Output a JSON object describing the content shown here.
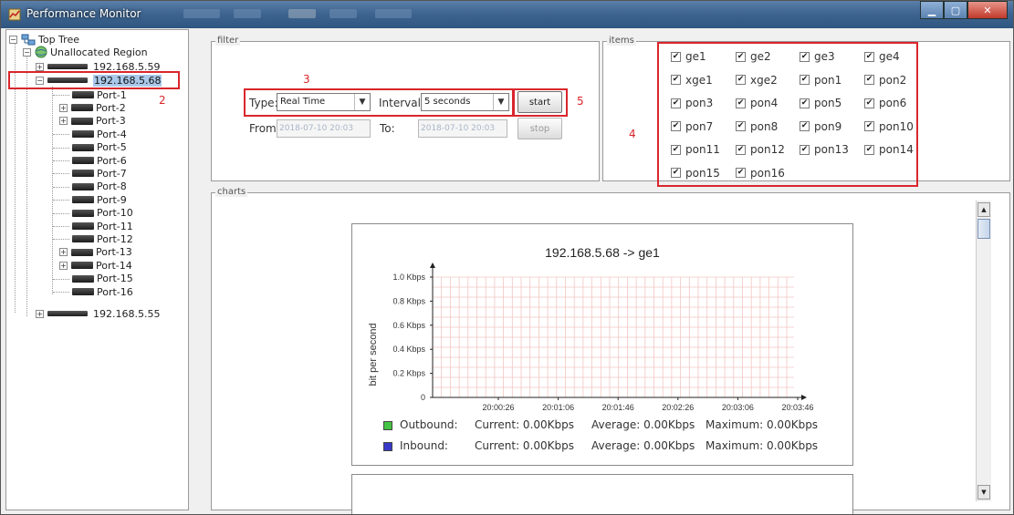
{
  "window": {
    "title": "Performance Monitor"
  },
  "tree": {
    "root": "Top Tree",
    "region": "Unallocated Region",
    "devices": [
      "192.168.5.59",
      "192.168.5.68",
      "192.168.5.55"
    ],
    "ports": [
      "Port-1",
      "Port-2",
      "Port-3",
      "Port-4",
      "Port-5",
      "Port-6",
      "Port-7",
      "Port-8",
      "Port-9",
      "Port-10",
      "Port-11",
      "Port-12",
      "Port-13",
      "Port-14",
      "Port-15",
      "Port-16"
    ]
  },
  "annotations": {
    "n2": "2",
    "n3": "3",
    "n4": "4",
    "n5": "5"
  },
  "filter": {
    "title": "filter",
    "type_label": "Type:",
    "type_value": "Real Time",
    "interval_label": "Interval:",
    "interval_value": "5 seconds",
    "from_label": "From:",
    "from_value": "2018-07-10 20:03",
    "to_label": "To:",
    "to_value": "2018-07-10 20:03",
    "start_label": "start",
    "stop_label": "stop"
  },
  "items": {
    "title": "items",
    "list": [
      "ge1",
      "ge2",
      "ge3",
      "ge4",
      "xge1",
      "xge2",
      "pon1",
      "pon2",
      "pon3",
      "pon4",
      "pon5",
      "pon6",
      "pon7",
      "pon8",
      "pon9",
      "pon10",
      "pon11",
      "pon12",
      "pon13",
      "pon14",
      "pon15",
      "pon16"
    ]
  },
  "charts": {
    "title": "charts",
    "legend": {
      "outbound": {
        "label": "Outbound:",
        "current": "Current: 0.00Kbps",
        "average": "Average: 0.00Kbps",
        "maximum": "Maximum: 0.00Kbps",
        "color": "#44c444"
      },
      "inbound": {
        "label": "Inbound:",
        "current": "Current: 0.00Kbps",
        "average": "Average: 0.00Kbps",
        "maximum": "Maximum: 0.00Kbps",
        "color": "#3a3ac8"
      }
    }
  },
  "chart_data": {
    "type": "line",
    "title": "192.168.5.68 -> ge1",
    "ylabel": "bit per second",
    "xlabel": "",
    "y_ticks": [
      "0",
      "0.2 Kbps",
      "0.4 Kbps",
      "0.6 Kbps",
      "0.8 Kbps",
      "1.0 Kbps"
    ],
    "x_ticks": [
      "20:00:26",
      "20:01:06",
      "20:01:46",
      "20:02:26",
      "20:03:06",
      "20:03:46"
    ],
    "ylim": [
      0,
      1.0
    ],
    "grid": true,
    "series": [
      {
        "name": "Outbound",
        "values": []
      },
      {
        "name": "Inbound",
        "values": []
      }
    ]
  }
}
